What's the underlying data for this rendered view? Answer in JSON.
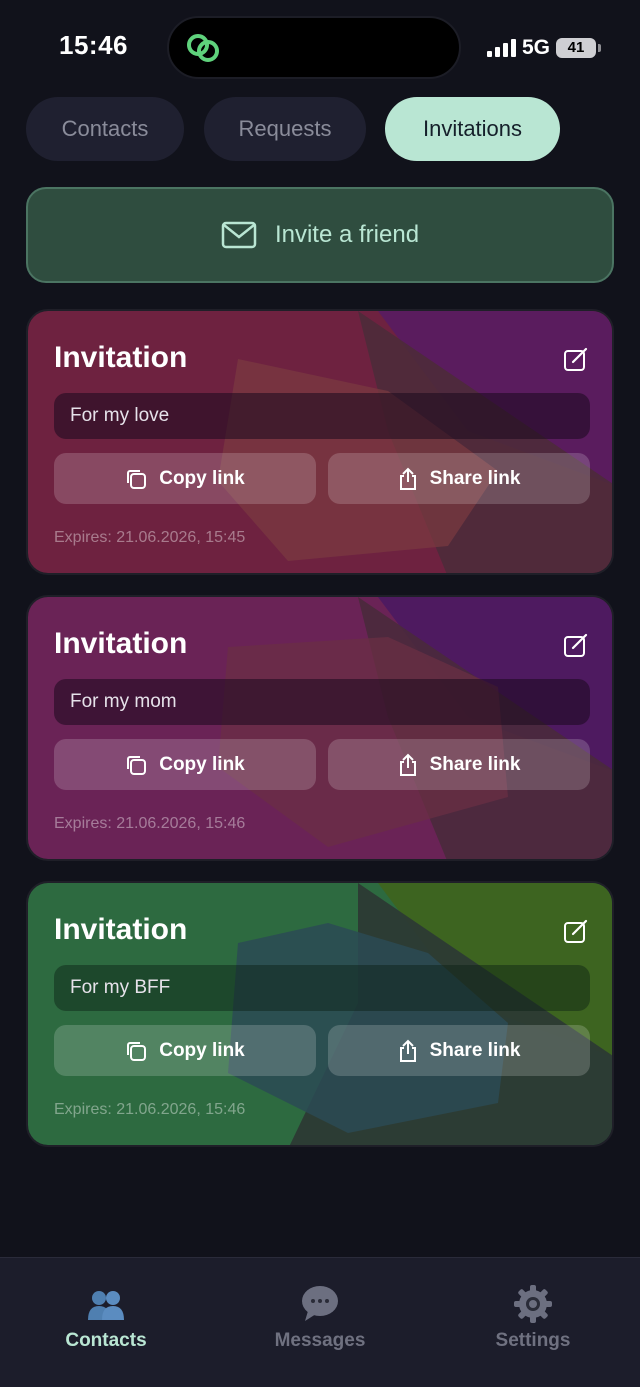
{
  "status_bar": {
    "time": "15:46",
    "network": "5G",
    "battery": "41"
  },
  "tabs": [
    {
      "label": "Contacts",
      "active": false
    },
    {
      "label": "Requests",
      "active": false
    },
    {
      "label": "Invitations",
      "active": true
    }
  ],
  "invite_button": {
    "label": "Invite a friend",
    "icon": "mail-icon"
  },
  "invitations": [
    {
      "title": "Invitation",
      "name": "For my love",
      "copy_label": "Copy link",
      "share_label": "Share link",
      "expires": "Expires: 21.06.2026, 15:45",
      "theme": "pink"
    },
    {
      "title": "Invitation",
      "name": "For my mom",
      "copy_label": "Copy link",
      "share_label": "Share link",
      "expires": "Expires: 21.06.2026, 15:46",
      "theme": "purple"
    },
    {
      "title": "Invitation",
      "name": "For my BFF",
      "copy_label": "Copy link",
      "share_label": "Share link",
      "expires": "Expires: 21.06.2026, 15:46",
      "theme": "green"
    }
  ],
  "bottom_nav": [
    {
      "label": "Contacts",
      "icon": "contacts-icon",
      "active": true
    },
    {
      "label": "Messages",
      "icon": "chat-bubble-icon",
      "active": false
    },
    {
      "label": "Settings",
      "icon": "gear-icon",
      "active": false
    }
  ],
  "colors": {
    "accent": "#b9e6d3",
    "background": "#11121b",
    "tab_inactive": "#1f2030"
  }
}
